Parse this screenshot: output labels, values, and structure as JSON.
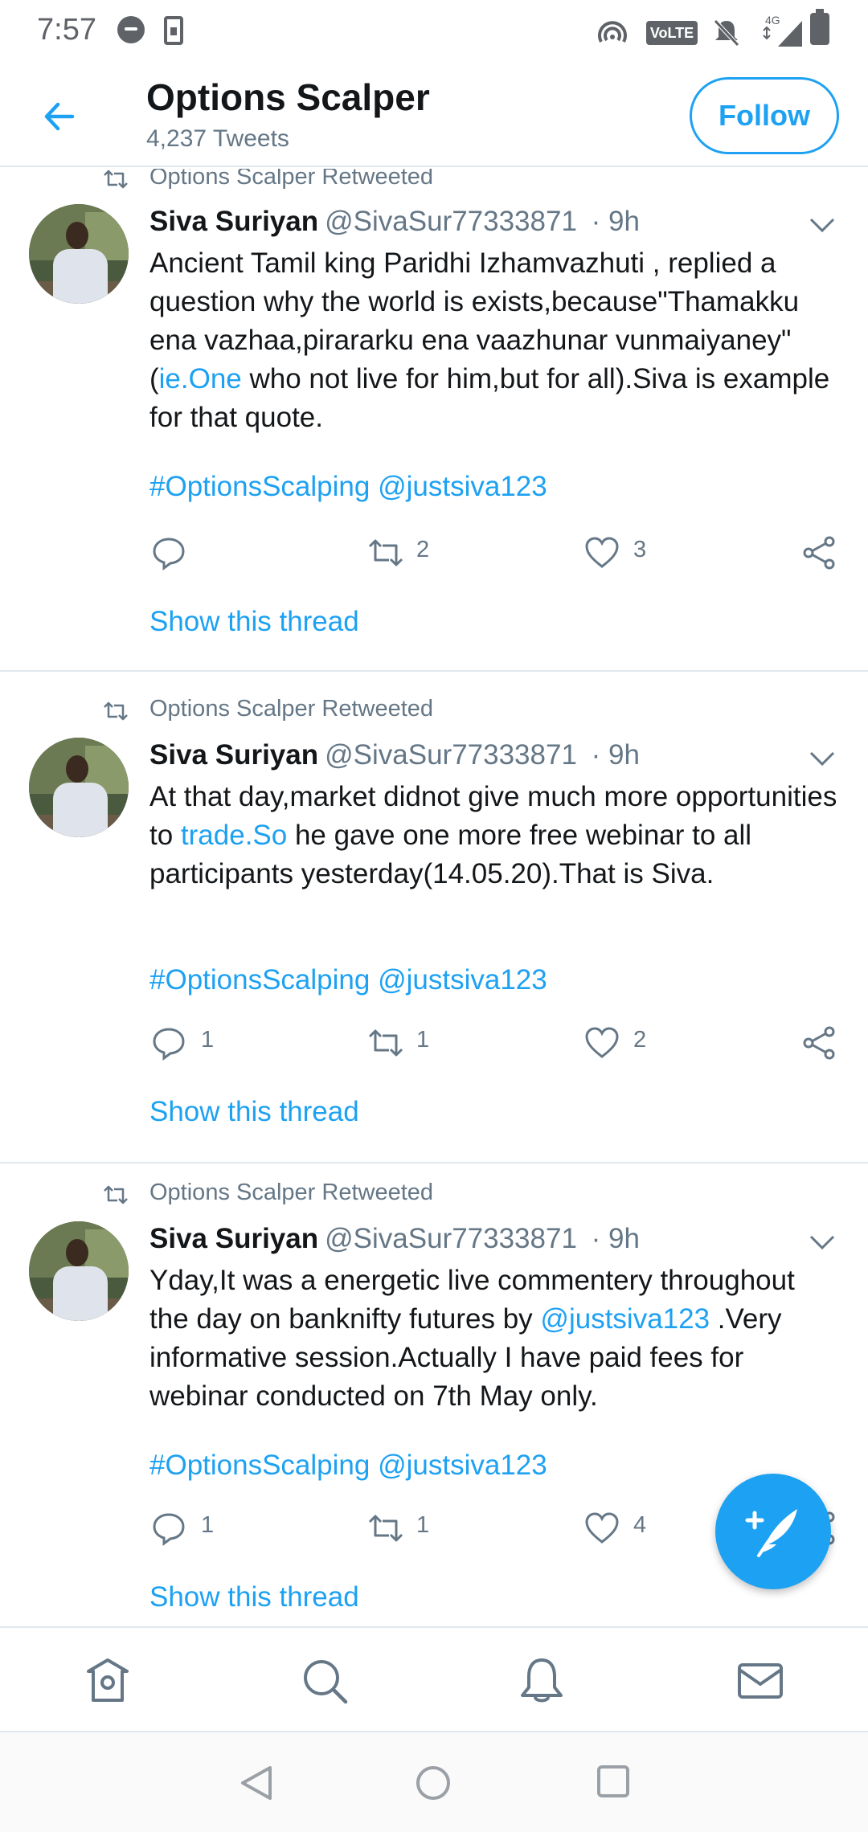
{
  "status_bar": {
    "time": "7:57",
    "volte": "VoLTE",
    "network": "4G"
  },
  "header": {
    "title": "Options Scalper",
    "subtitle": "4,237 Tweets",
    "follow_label": "Follow"
  },
  "tweets": [
    {
      "retweeted_by": "Options Scalper Retweeted",
      "author_name": "Siva Suriyan",
      "handle": "@SivaSur77333871",
      "time": "· 9h",
      "text_1": "Ancient Tamil king  Paridhi Izhamvazhuti , replied a question why the world is exists,because\"Thamakku ena vazhaa,pirararku ena vaazhunar vunmaiyaney\" (",
      "link": "ie.One",
      "text_2": " who not live for him,but for all).Siva is example for that quote.",
      "hashtag": "#OptionsScalping",
      "mention": "@justsiva123",
      "reply_count": "",
      "retweet_count": "2",
      "like_count": "3",
      "show_thread": "Show this thread"
    },
    {
      "retweeted_by": "Options Scalper Retweeted",
      "author_name": "Siva Suriyan",
      "handle": "@SivaSur77333871",
      "time": "· 9h",
      "text_1": "At that day,market didnot give much more opportunities to ",
      "link": "trade.So",
      "text_2": " he gave one more free webinar to all participants yesterday(14.05.20).That is Siva.",
      "hashtag": "#OptionsScalping",
      "mention": "@justsiva123",
      "reply_count": "1",
      "retweet_count": "1",
      "like_count": "2",
      "show_thread": "Show this thread"
    },
    {
      "retweeted_by": "Options Scalper Retweeted",
      "author_name": "Siva Suriyan",
      "handle": "@SivaSur77333871",
      "time": "· 9h",
      "text_1": "Yday,It was a energetic live commentery throughout the day on banknifty futures by ",
      "link": "@justsiva123",
      "text_2": " .Very informative session.Actually I have paid fees for webinar conducted on 7th May only.",
      "hashtag": "#OptionsScalping",
      "mention": "@justsiva123",
      "reply_count": "1",
      "retweet_count": "1",
      "like_count": "4",
      "show_thread": "Show this thread"
    }
  ],
  "icons": {
    "back": "arrow-left-icon",
    "reply": "speech-bubble-icon",
    "retweet": "retweet-icon",
    "like": "heart-icon",
    "share": "share-icon",
    "compose": "feather-plus-icon",
    "home": "home-icon",
    "search": "search-icon",
    "notifications": "bell-icon",
    "messages": "envelope-icon"
  },
  "colors": {
    "accent": "#1da1f2",
    "text_primary": "#14171a",
    "text_secondary": "#657786",
    "divider": "#e1e8ed"
  }
}
